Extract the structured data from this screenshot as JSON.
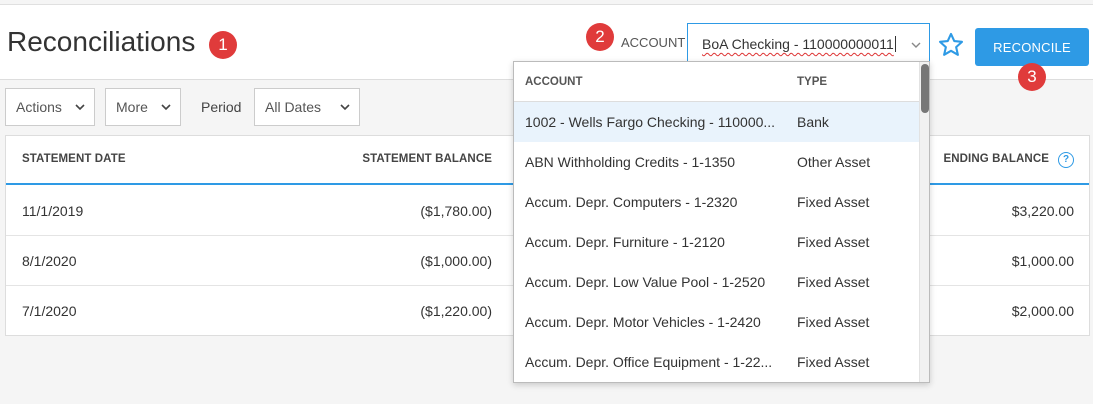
{
  "page": {
    "title": "Reconciliations",
    "badges": [
      "1",
      "2",
      "3"
    ]
  },
  "account": {
    "label": "ACCOUNT",
    "selected_value": "BoA Checking - 110000000011"
  },
  "actions": {
    "reconcile_label": "RECONCILE"
  },
  "toolbar": {
    "actions_label": "Actions",
    "more_label": "More",
    "period_label": "Period",
    "period_value": "All Dates"
  },
  "table": {
    "headers": {
      "statement_date": "STATEMENT DATE",
      "statement_balance": "STATEMENT BALANCE",
      "ending_balance": "ENDING BALANCE"
    },
    "rows": [
      {
        "statement_date": "11/1/2019",
        "statement_balance": "($1,780.00)",
        "ending_balance": "$3,220.00"
      },
      {
        "statement_date": "8/1/2020",
        "statement_balance": "($1,000.00)",
        "ending_balance": "$1,000.00"
      },
      {
        "statement_date": "7/1/2020",
        "statement_balance": "($1,220.00)",
        "ending_balance": "$2,000.00"
      }
    ]
  },
  "dropdown": {
    "headers": {
      "account": "ACCOUNT",
      "type": "TYPE"
    },
    "items": [
      {
        "name": "1002 - Wells Fargo Checking - 110000...",
        "type": "Bank"
      },
      {
        "name": "ABN Withholding Credits - 1-1350",
        "type": "Other Asset"
      },
      {
        "name": "Accum. Depr. Computers - 1-2320",
        "type": "Fixed Asset"
      },
      {
        "name": "Accum. Depr. Furniture - 1-2120",
        "type": "Fixed Asset"
      },
      {
        "name": "Accum. Depr. Low Value Pool - 1-2520",
        "type": "Fixed Asset"
      },
      {
        "name": "Accum. Depr. Motor Vehicles - 1-2420",
        "type": "Fixed Asset"
      },
      {
        "name": "Accum. Depr. Office Equipment - 1-22...",
        "type": "Fixed Asset"
      }
    ]
  },
  "colors": {
    "accent": "#2e9ae5",
    "badge": "#e03b3b",
    "highlight": "#e9f3fc"
  },
  "icons": [
    "chevron-down-icon",
    "star-icon",
    "help-icon"
  ]
}
